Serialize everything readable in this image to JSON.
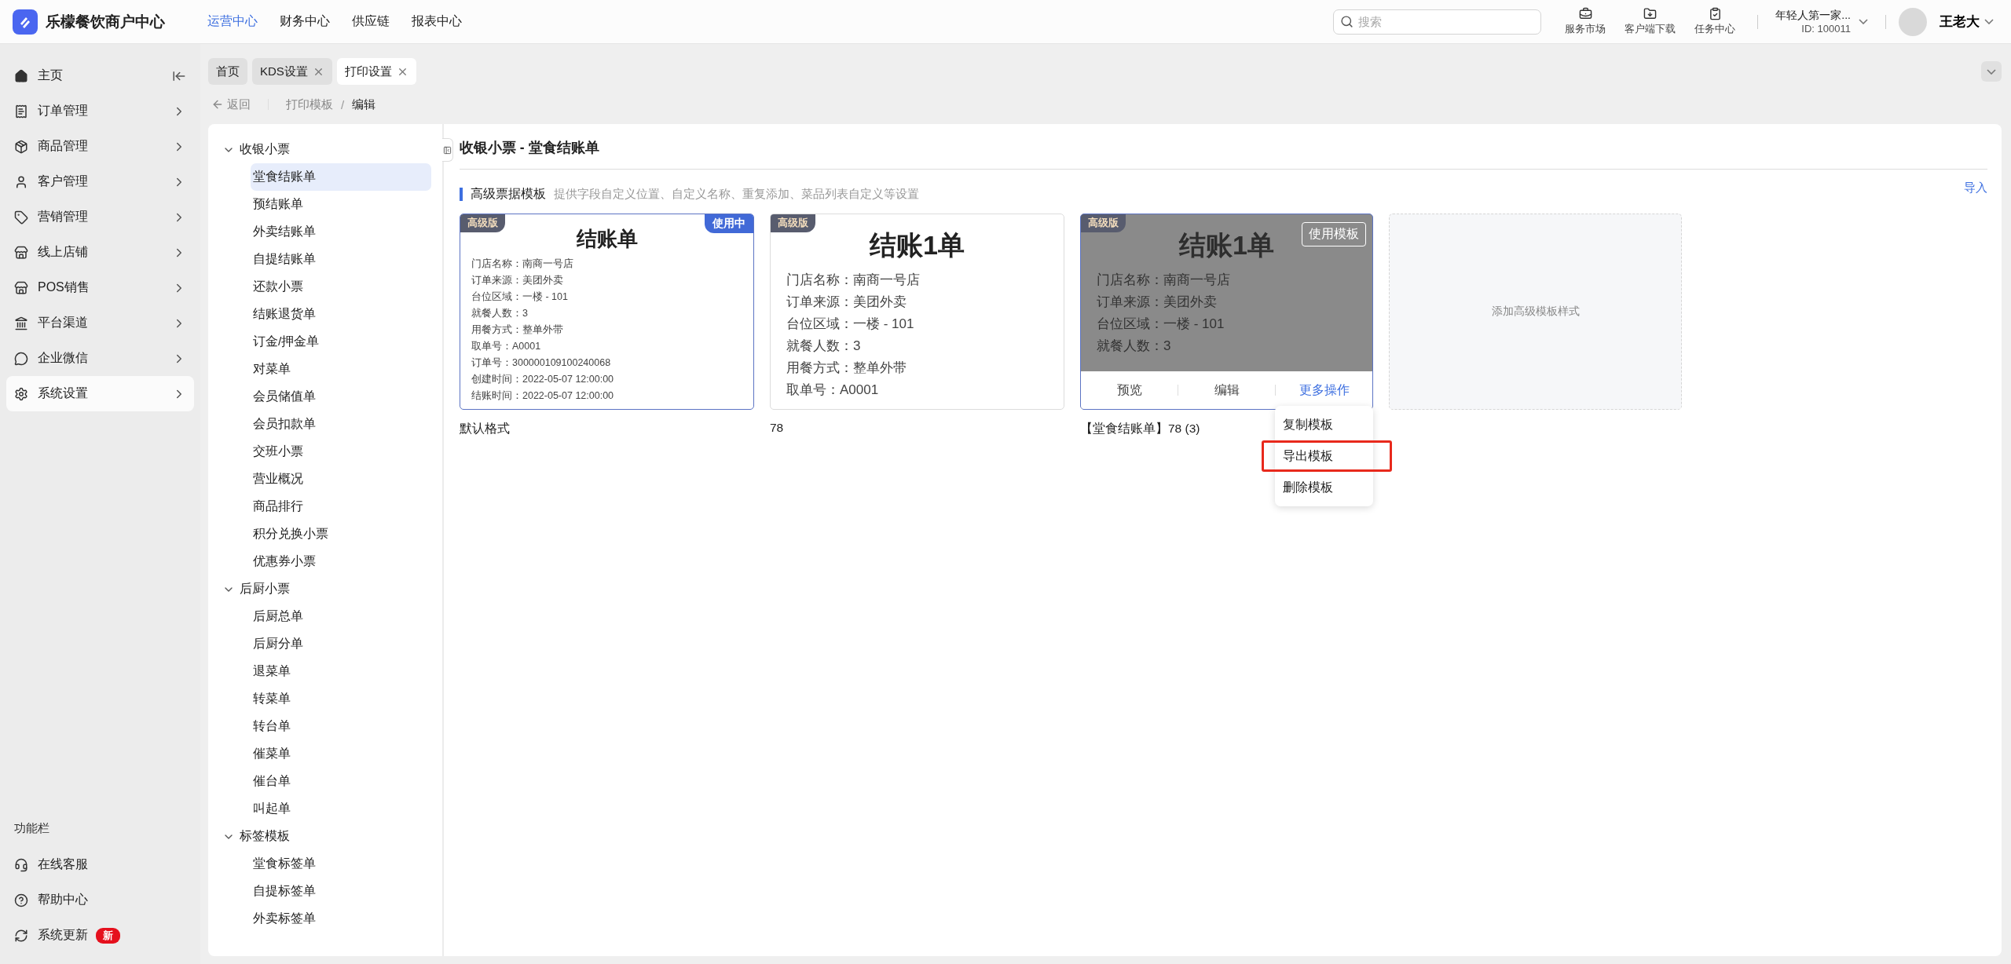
{
  "brand": "乐檬餐饮商户中心",
  "top_nav": [
    {
      "label": "运营中心",
      "selected": true
    },
    {
      "label": "财务中心",
      "selected": false
    },
    {
      "label": "供应链",
      "selected": false
    },
    {
      "label": "报表中心",
      "selected": false
    }
  ],
  "search": {
    "placeholder": "搜索"
  },
  "top_actions": [
    {
      "label": "服务市场"
    },
    {
      "label": "客户端下载"
    },
    {
      "label": "任务中心"
    }
  ],
  "store": {
    "name": "年轻人第一家...",
    "id": "ID: 100011"
  },
  "user": {
    "name": "王老大"
  },
  "sidebar": {
    "items": [
      {
        "label": "主页",
        "selected": false,
        "kind": "home"
      },
      {
        "label": "订单管理",
        "selected": false,
        "kind": "menu"
      },
      {
        "label": "商品管理",
        "selected": false,
        "kind": "menu"
      },
      {
        "label": "客户管理",
        "selected": false,
        "kind": "menu"
      },
      {
        "label": "营销管理",
        "selected": false,
        "kind": "menu"
      },
      {
        "label": "线上店铺",
        "selected": false,
        "kind": "menu"
      },
      {
        "label": "POS销售",
        "selected": false,
        "kind": "menu"
      },
      {
        "label": "平台渠道",
        "selected": false,
        "kind": "menu"
      },
      {
        "label": "企业微信",
        "selected": false,
        "kind": "menu"
      },
      {
        "label": "系统设置",
        "selected": true,
        "kind": "menu"
      }
    ],
    "footer_title": "功能栏",
    "footer_items": [
      {
        "label": "在线客服"
      },
      {
        "label": "帮助中心"
      },
      {
        "label": "系统更新",
        "badge": "新"
      }
    ]
  },
  "tabs": [
    {
      "label": "首页",
      "selected": false,
      "closable": false
    },
    {
      "label": "KDS设置",
      "selected": false,
      "closable": true
    },
    {
      "label": "打印设置",
      "selected": true,
      "closable": true
    }
  ],
  "breadcrumb": {
    "back": "返回",
    "separator": "/",
    "items": [
      "打印模板",
      "编辑"
    ]
  },
  "tree": [
    {
      "label": "收银小票",
      "expanded": true,
      "children": [
        {
          "label": "堂食结账单",
          "selected": true
        },
        {
          "label": "预结账单",
          "selected": false
        },
        {
          "label": "外卖结账单",
          "selected": false
        },
        {
          "label": "自提结账单",
          "selected": false
        },
        {
          "label": "还款小票",
          "selected": false
        },
        {
          "label": "结账退货单",
          "selected": false
        },
        {
          "label": "订金/押金单",
          "selected": false
        },
        {
          "label": "对菜单",
          "selected": false
        },
        {
          "label": "会员储值单",
          "selected": false
        },
        {
          "label": "会员扣款单",
          "selected": false
        },
        {
          "label": "交班小票",
          "selected": false
        },
        {
          "label": "营业概况",
          "selected": false
        },
        {
          "label": "商品排行",
          "selected": false
        },
        {
          "label": "积分兑换小票",
          "selected": false
        },
        {
          "label": "优惠券小票",
          "selected": false
        }
      ]
    },
    {
      "label": "后厨小票",
      "expanded": true,
      "children": [
        {
          "label": "后厨总单",
          "selected": false
        },
        {
          "label": "后厨分单",
          "selected": false
        },
        {
          "label": "退菜单",
          "selected": false
        },
        {
          "label": "转菜单",
          "selected": false
        },
        {
          "label": "转台单",
          "selected": false
        },
        {
          "label": "催菜单",
          "selected": false
        },
        {
          "label": "催台单",
          "selected": false
        },
        {
          "label": "叫起单",
          "selected": false
        }
      ]
    },
    {
      "label": "标签模板",
      "expanded": true,
      "children": [
        {
          "label": "堂食标签单",
          "selected": false
        },
        {
          "label": "自提标签单",
          "selected": false
        },
        {
          "label": "外卖标签单",
          "selected": false
        }
      ]
    }
  ],
  "page_title": "收银小票 - 堂食结账单",
  "section": {
    "title": "高级票据模板",
    "description": "提供字段自定义位置、自定义名称、重复添加、菜品列表自定义等设置",
    "import": "导入"
  },
  "templates": [
    {
      "kind": "compact",
      "badge": "高级版",
      "status": "使用中",
      "in_use": true,
      "hovered": false,
      "title": "结账单",
      "fields": [
        "门店名称：南商一号店",
        "订单来源：美团外卖",
        "台位区域：一楼 - 101",
        "就餐人数：3",
        "用餐方式：整单外带",
        "取单号：A0001",
        "订单号：300000109100240068",
        "创建时间：2022-05-07 12:00:00",
        "结账时间：2022-05-07 12:00:00"
      ],
      "caption": "默认格式"
    },
    {
      "kind": "standard",
      "badge": "高级版",
      "in_use": false,
      "hovered": false,
      "title": "结账1单",
      "fields": [
        "门店名称：南商一号店",
        "订单来源：美团外卖",
        "台位区域：一楼 - 101",
        "就餐人数：3",
        "用餐方式：整单外带",
        "取单号：A0001"
      ],
      "caption": "78"
    },
    {
      "kind": "standard",
      "badge": "高级版",
      "in_use": false,
      "hovered": true,
      "title": "结账1单",
      "use_button": "使用模板",
      "actions": [
        {
          "label": "预览",
          "kind": "plain"
        },
        {
          "label": "编辑",
          "kind": "plain"
        },
        {
          "label": "更多操作",
          "kind": "link"
        }
      ],
      "fields": [
        "门店名称：南商一号店",
        "订单来源：美团外卖",
        "台位区域：一楼 - 101",
        "就餐人数：3"
      ],
      "caption": "【堂食结账单】78 (3)",
      "menu": [
        {
          "label": "复制模板",
          "highlighted": false
        },
        {
          "label": "导出模板",
          "highlighted": true
        },
        {
          "label": "删除模板",
          "highlighted": false
        }
      ]
    }
  ],
  "add_card": {
    "label": "添加高级模板样式"
  }
}
